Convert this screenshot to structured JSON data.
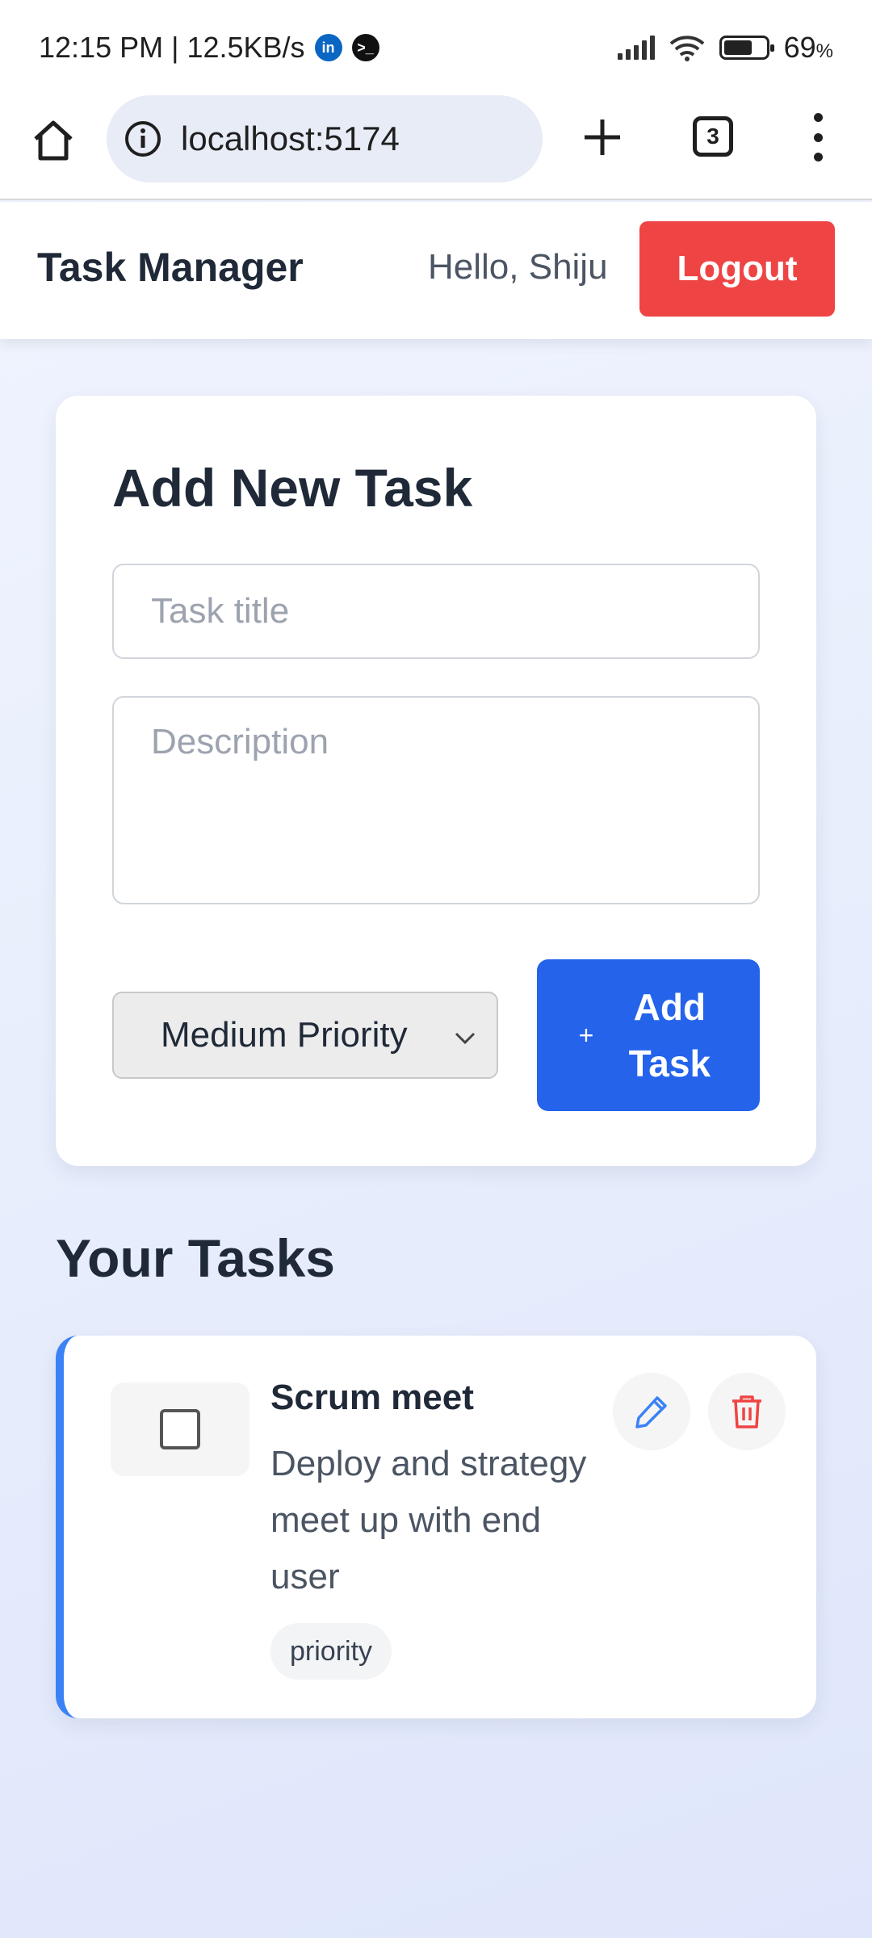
{
  "status_bar": {
    "time_info": "12:15 PM | 12.5KB/s",
    "apps": [
      "linkedin-icon",
      "terminal-icon"
    ],
    "battery_percent": "69",
    "battery_unit": "%",
    "battery_level": 0.69
  },
  "browser": {
    "url": "localhost:5174",
    "tab_count": "3"
  },
  "header": {
    "brand": "Task Manager",
    "greeting": "Hello, Shiju",
    "logout_label": "Logout"
  },
  "add_task": {
    "title": "Add New Task",
    "title_placeholder": "Task title",
    "title_value": "",
    "description_placeholder": "Description",
    "description_value": "",
    "priority_selected": "Medium Priority",
    "add_plus": "+",
    "add_label": "Add Task"
  },
  "tasks_section": {
    "title": "Your Tasks",
    "tasks": [
      {
        "title": "Scrum meet",
        "description": "Deploy and strategy meet up with end user",
        "badge": "priority",
        "completed": false
      }
    ]
  },
  "colors": {
    "accent": "#2563eb",
    "danger": "#ef4444",
    "task_border": "#3b82f6",
    "text_dark": "#1f2937"
  }
}
